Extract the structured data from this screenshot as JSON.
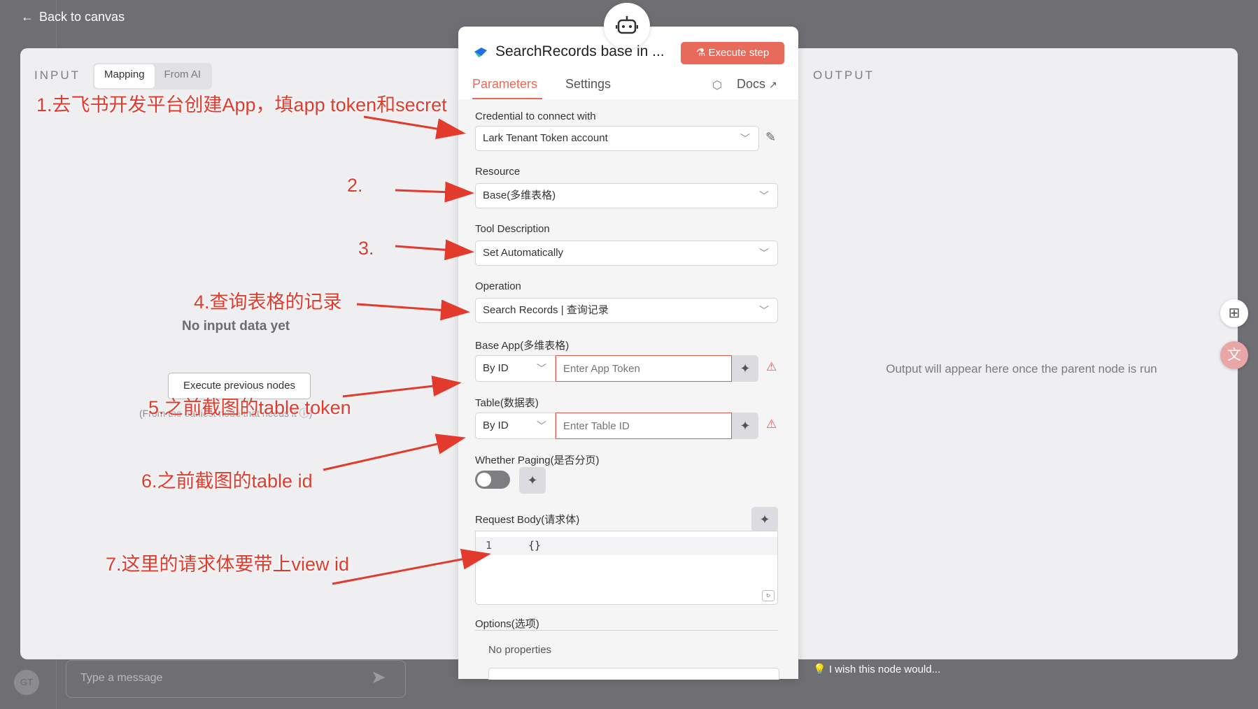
{
  "topbar": {
    "back_label": "Back to canvas"
  },
  "input_panel": {
    "title": "INPUT",
    "tabs": [
      "Mapping",
      "From AI"
    ],
    "empty_text": "No input data yet",
    "execute_previous_label": "Execute previous nodes",
    "hint_text": "(From the earliest node that needs it ⓘ)"
  },
  "output_panel": {
    "title": "OUTPUT",
    "empty_text": "Output will appear here once the parent node is run"
  },
  "node": {
    "title": "SearchRecords base in ...",
    "execute_step_label": "Execute step",
    "tabs": {
      "parameters": "Parameters",
      "settings": "Settings"
    },
    "docs_label": "Docs"
  },
  "fields": {
    "credential": {
      "label": "Credential to connect with",
      "value": "Lark Tenant Token account"
    },
    "resource": {
      "label": "Resource",
      "value": "Base(多维表格)"
    },
    "tool_description": {
      "label": "Tool Description",
      "value": "Set Automatically"
    },
    "operation": {
      "label": "Operation",
      "value": "Search Records | 查询记录"
    },
    "base_app": {
      "label": "Base App(多维表格)",
      "mode": "By ID",
      "placeholder": "Enter App Token"
    },
    "table": {
      "label": "Table(数据表)",
      "mode": "By ID",
      "placeholder": "Enter Table ID"
    },
    "paging": {
      "label": "Whether Paging(是否分页)",
      "enabled": false
    },
    "request_body": {
      "label": "Request Body(请求体)",
      "line_number": "1",
      "code": "{}"
    },
    "options": {
      "label": "Options(选项)",
      "empty_text": "No properties"
    }
  },
  "chat": {
    "placeholder": "Type a message",
    "avatar_initials": "GT"
  },
  "feedback": {
    "label": "I wish this node would..."
  },
  "annotations": [
    "1.去飞书开发平台创建App，填app token和secret",
    "2.",
    "3.",
    "4.查询表格的记录",
    "5.之前截图的table token",
    "6.之前截图的table id",
    "7.这里的请求体要带上view id"
  ],
  "colors": {
    "accent": "#e86a5b",
    "annotation": "#e23b2e",
    "error_border": "#e05a4a"
  }
}
